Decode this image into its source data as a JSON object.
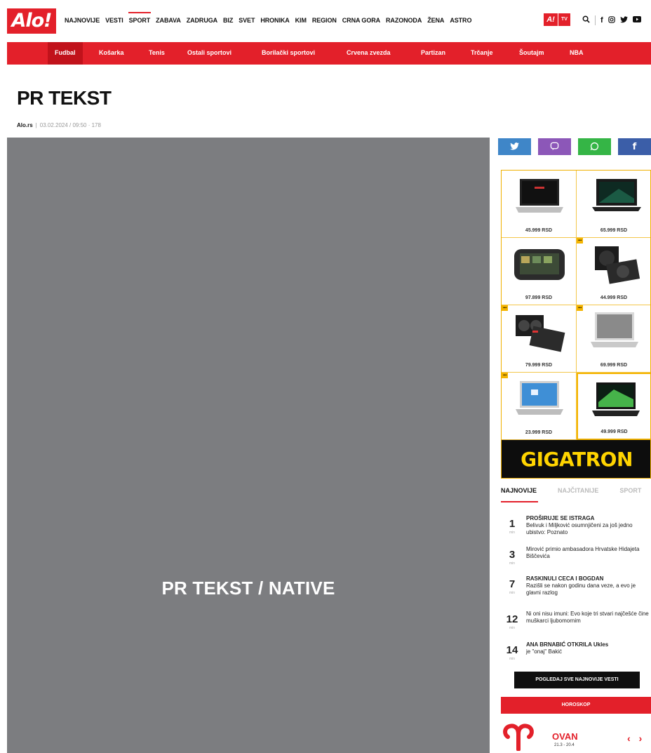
{
  "header": {
    "logo": "Alo!",
    "nav": [
      "NAJNOVIJE",
      "VESTI",
      "SPORT",
      "ZABAVA",
      "ZADRUGA",
      "BIZ",
      "SVET",
      "HRONIKA",
      "KIM",
      "REGION",
      "CRNA GORA",
      "RAZONODA",
      "ŽENA",
      "ASTRO"
    ],
    "active_nav": "SPORT",
    "altv_a": "A!",
    "altv_tv": "TV",
    "icons": [
      "search-icon",
      "facebook-icon",
      "instagram-icon",
      "twitter-icon",
      "youtube-icon"
    ],
    "colors": {
      "accent": "#e3202a"
    }
  },
  "subnav": [
    "Fudbal",
    "Košarka",
    "Tenis",
    "Ostali sportovi",
    "Borilački sportovi",
    "Crvena zvezda",
    "Partizan",
    "Trčanje",
    "Šoutajm",
    "NBA"
  ],
  "article": {
    "title": "PR TEKST",
    "author": "Alo.rs",
    "meta": "03.02.2024 / 09:50 · 178"
  },
  "hero": {
    "label": "PR TEKST / NATIVE"
  },
  "share": [
    "t",
    "v",
    "w",
    "f"
  ],
  "ad": {
    "prices": [
      "45.999 RSD",
      "65.999 RSD",
      "97.899 RSD",
      "44.999 RSD",
      "79.999 RSD",
      "69.999 RSD",
      "23.999 RSD",
      "49.999 RSD"
    ],
    "brand": "GIGATRON"
  },
  "tabs": [
    "NAJNOVIJE",
    "NAJČITANIJE",
    "SPORT"
  ],
  "news": [
    {
      "num": "1",
      "min": "min",
      "title": "PROŠIRUJE SE ISTRAGA",
      "text": "Belivuk i Miljković osumnjičeni za još jedno ubistvo: Poznato"
    },
    {
      "num": "3",
      "min": "min",
      "title": "",
      "text": "Mirović primio ambasadora Hrvatske Hidajeta Biščevića"
    },
    {
      "num": "7",
      "min": "min",
      "title": "RASKINULI CECA I BOGDAN",
      "text": "Razišli se nakon godinu dana veze, a evo je glavni razlog"
    },
    {
      "num": "12",
      "min": "min",
      "title": "",
      "text": "Ni oni nisu imuni: Evo koje tri stvari najčešće čine muškarci ljubomornim"
    },
    {
      "num": "14",
      "min": "min",
      "title": "ANA BRNABIĆ OTKRILA Ukles",
      "text": "je \"onaj\" Bakić"
    }
  ],
  "all_news_btn": "POGLEDAJ SVE NAJNOVIJE VESTI",
  "horoscope": {
    "bar": "HOROSKOP",
    "sign": "OVAN",
    "dates": "21.3 - 20.4"
  }
}
